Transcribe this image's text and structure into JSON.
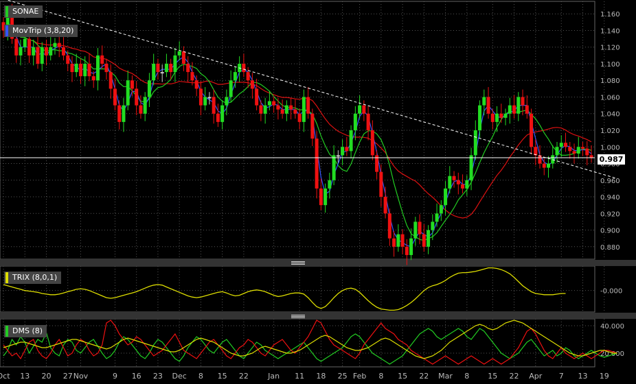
{
  "instrument": {
    "name": "SONAE",
    "name_color": "#22cc22"
  },
  "indicators": {
    "movtrip": {
      "label": "MovTrip (3,8,20)",
      "color": "#3355ff"
    },
    "trix": {
      "label": "TRIX (8,0,1)",
      "color": "#dddd00"
    },
    "dms": {
      "label": "DMS (8)",
      "color": "#22cc22"
    }
  },
  "last_price": "0.987",
  "colors": {
    "up": "#22dd22",
    "down": "#ee1111",
    "neutral": "#cccccc",
    "ma3": "#3355ff",
    "ma8": "#22cc22",
    "ma20": "#dd1111",
    "trendline": "#ffffff",
    "trix": "#dddd00",
    "dms_plus": "#22cc22",
    "dms_minus": "#ee1111",
    "adx": "#dddd00"
  },
  "chart_data": [
    {
      "type": "candlestick",
      "series_name": "SONAE",
      "y_ticks": [
        "1.160",
        "1.140",
        "1.120",
        "1.100",
        "1.080",
        "1.060",
        "1.040",
        "1.020",
        "1.000",
        "0.980",
        "0.960",
        "0.940",
        "0.920",
        "0.900",
        "0.880"
      ],
      "ylim": [
        0.865,
        1.175
      ],
      "x_ticks": [
        "Oct",
        "13",
        "20",
        "27",
        "Nov",
        "9",
        "16",
        "23",
        "Dec",
        "8",
        "15",
        "22",
        "Jan",
        "11",
        "18",
        "25",
        "Feb",
        "8",
        "15",
        "22",
        "Mar",
        "8",
        "15",
        "22",
        "Apr",
        "7",
        "13",
        "19"
      ],
      "x_tick_index": [
        0,
        5,
        10,
        15,
        18,
        26,
        31,
        36,
        41,
        46,
        51,
        56,
        63,
        69,
        74,
        79,
        83,
        88,
        93,
        98,
        103,
        108,
        114,
        119,
        124,
        130,
        135,
        140
      ],
      "last_value": 0.987,
      "trendline": {
        "start": [
          0,
          1.178
        ],
        "end": [
          143,
          0.962
        ]
      },
      "horizontal_line": 0.987,
      "close": [
        1.14,
        1.16,
        1.13,
        1.11,
        1.12,
        1.13,
        1.11,
        1.12,
        1.1,
        1.12,
        1.11,
        1.12,
        1.125,
        1.12,
        1.11,
        1.1,
        1.09,
        1.1,
        1.085,
        1.1,
        1.085,
        1.08,
        1.11,
        1.1,
        1.09,
        1.07,
        1.05,
        1.03,
        1.05,
        1.08,
        1.07,
        1.05,
        1.04,
        1.06,
        1.08,
        1.1,
        1.09,
        1.09,
        1.1,
        1.09,
        1.11,
        1.115,
        1.1,
        1.09,
        1.08,
        1.07,
        1.05,
        1.06,
        1.06,
        1.04,
        1.03,
        1.05,
        1.06,
        1.08,
        1.09,
        1.1,
        1.09,
        1.08,
        1.07,
        1.05,
        1.04,
        1.05,
        1.055,
        1.05,
        1.045,
        1.04,
        1.05,
        1.045,
        1.04,
        1.03,
        1.06,
        1.04,
        1.01,
        0.95,
        0.93,
        0.95,
        0.96,
        0.99,
        0.99,
        1.0,
        0.995,
        1.02,
        1.04,
        1.05,
        1.04,
        1.02,
        0.99,
        0.97,
        0.94,
        0.92,
        0.89,
        0.88,
        0.895,
        0.88,
        0.87,
        0.89,
        0.91,
        0.895,
        0.88,
        0.9,
        0.91,
        0.92,
        0.93,
        0.95,
        0.965,
        0.96,
        0.955,
        0.95,
        0.96,
        0.99,
        1.02,
        1.05,
        1.06,
        1.04,
        1.03,
        1.04,
        1.035,
        1.04,
        1.05,
        1.04,
        1.06,
        1.05,
        1.04,
        1.0,
        0.99,
        0.98,
        0.975,
        0.98,
        0.99,
        1.0,
        1.005,
        1.0,
        0.995,
        0.992,
        1.0,
        0.998,
        0.99,
        0.987
      ],
      "trix": [
        0.1,
        0.08,
        0.06,
        0.04,
        0.02,
        0.0,
        -0.01,
        -0.02,
        -0.03,
        -0.05,
        -0.06,
        -0.07,
        -0.07,
        -0.06,
        -0.04,
        -0.02,
        0.0,
        0.02,
        0.03,
        0.02,
        0.0,
        -0.03,
        -0.06,
        -0.09,
        -0.12,
        -0.13,
        -0.12,
        -0.1,
        -0.08,
        -0.06,
        -0.04,
        -0.02,
        0.01,
        0.04,
        0.07,
        0.09,
        0.1,
        0.09,
        0.06,
        0.03,
        0.0,
        -0.03,
        -0.06,
        -0.09,
        -0.11,
        -0.12,
        -0.11,
        -0.09,
        -0.07,
        -0.05,
        -0.03,
        -0.02,
        -0.04,
        -0.07,
        -0.09,
        -0.08,
        -0.05,
        -0.02,
        0.0,
        0.01,
        0.0,
        -0.02,
        -0.05,
        -0.08,
        -0.1,
        -0.09,
        -0.07,
        -0.05,
        -0.04,
        -0.04,
        -0.06,
        -0.12,
        -0.2,
        -0.27,
        -0.3,
        -0.27,
        -0.2,
        -0.12,
        -0.05,
        0.0,
        0.03,
        0.04,
        0.02,
        -0.03,
        -0.1,
        -0.17,
        -0.23,
        -0.28,
        -0.31,
        -0.32,
        -0.33,
        -0.33,
        -0.32,
        -0.29,
        -0.25,
        -0.2,
        -0.14,
        -0.07,
        0.0,
        0.05,
        0.08,
        0.1,
        0.13,
        0.17,
        0.22,
        0.26,
        0.29,
        0.3,
        0.3,
        0.31,
        0.32,
        0.34,
        0.36,
        0.38,
        0.38,
        0.37,
        0.35,
        0.32,
        0.28,
        0.22,
        0.15,
        0.08,
        0.03,
        -0.02,
        -0.05,
        -0.06,
        -0.07,
        -0.07,
        -0.07,
        -0.06,
        -0.05,
        -0.05
      ]
    },
    {
      "type": "line",
      "panel": "DMS (8)",
      "y_ticks": [
        "40.000",
        "20.000"
      ],
      "ylim": [
        10,
        45
      ],
      "series": [
        {
          "values": [
            18,
            22,
            30,
            26,
            32,
            28,
            20,
            25,
            30,
            28,
            35,
            24,
            20,
            18,
            26,
            30,
            28,
            22,
            20,
            24,
            28,
            30,
            25,
            20,
            16,
            18,
            22,
            28,
            32,
            30,
            26,
            22,
            18,
            16,
            20,
            26,
            30,
            28,
            24,
            20,
            16,
            14,
            18,
            24,
            28,
            32,
            30,
            26,
            22,
            20,
            24,
            28,
            30,
            26,
            22,
            18,
            16,
            20,
            24,
            28,
            26,
            22,
            20,
            18,
            16,
            18,
            20,
            22,
            24,
            26,
            28,
            24,
            20,
            16,
            14,
            16,
            18,
            20,
            22,
            24,
            28,
            32,
            34,
            32,
            28,
            24,
            20,
            18,
            16,
            14,
            12,
            14,
            16,
            18,
            22,
            26,
            30,
            34,
            36,
            38,
            36,
            32,
            30,
            32,
            34,
            36,
            38,
            36,
            32,
            30,
            34,
            38,
            36,
            32,
            28,
            24,
            20,
            18,
            16,
            18,
            20,
            24,
            28,
            30,
            26,
            22,
            18,
            20,
            22,
            18,
            20,
            24,
            22,
            18,
            16,
            18,
            20,
            22,
            20,
            18,
            17,
            18,
            19,
            20
          ]
        },
        {
          "values": [
            26,
            22,
            18,
            20,
            16,
            22,
            28,
            30,
            22,
            18,
            16,
            20,
            26,
            30,
            24,
            18,
            20,
            26,
            30,
            28,
            22,
            18,
            20,
            26,
            42,
            44,
            40,
            34,
            30,
            26,
            28,
            32,
            30,
            26,
            22,
            18,
            20,
            22,
            26,
            30,
            34,
            28,
            22,
            20,
            18,
            16,
            20,
            24,
            28,
            30,
            26,
            22,
            18,
            16,
            20,
            24,
            26,
            30,
            28,
            24,
            20,
            18,
            22,
            26,
            28,
            30,
            26,
            22,
            20,
            24,
            28,
            32,
            38,
            44,
            42,
            36,
            30,
            26,
            24,
            22,
            20,
            18,
            16,
            20,
            26,
            30,
            34,
            38,
            42,
            38,
            36,
            34,
            30,
            28,
            26,
            22,
            20,
            18,
            16,
            14,
            12,
            14,
            16,
            18,
            16,
            14,
            12,
            14,
            16,
            18,
            16,
            14,
            12,
            14,
            16,
            14,
            12,
            14,
            16,
            20,
            24,
            30,
            36,
            38,
            34,
            28,
            22,
            18,
            16,
            20,
            24,
            20,
            18,
            16,
            18,
            20,
            18,
            16,
            18,
            20,
            22,
            22,
            21,
            20
          ]
        },
        {
          "values": [
            24,
            25,
            26,
            27,
            28,
            28,
            27,
            26,
            25,
            24,
            24,
            25,
            26,
            27,
            28,
            29,
            30,
            30,
            29,
            28,
            27,
            26,
            25,
            24,
            23,
            24,
            26,
            28,
            30,
            31,
            30,
            29,
            28,
            27,
            26,
            25,
            24,
            23,
            22,
            21,
            21,
            22,
            24,
            26,
            28,
            30,
            31,
            30,
            29,
            28,
            26,
            24,
            22,
            20,
            19,
            18,
            18,
            19,
            20,
            22,
            24,
            25,
            24,
            23,
            22,
            21,
            20,
            20,
            21,
            22,
            24,
            26,
            28,
            30,
            32,
            33,
            32,
            30,
            28,
            26,
            24,
            23,
            22,
            22,
            23,
            24,
            26,
            28,
            30,
            31,
            30,
            28,
            26,
            24,
            22,
            20,
            18,
            17,
            16,
            17,
            18,
            20,
            22,
            25,
            28,
            30,
            32,
            34,
            36,
            38,
            40,
            41,
            40,
            38,
            37,
            38,
            40,
            42,
            43,
            44,
            43,
            42,
            40,
            38,
            36,
            34,
            32,
            30,
            28,
            26,
            24,
            22,
            20,
            19,
            18,
            18,
            19,
            20,
            21,
            22,
            22,
            21,
            20,
            20
          ]
        }
      ]
    }
  ]
}
